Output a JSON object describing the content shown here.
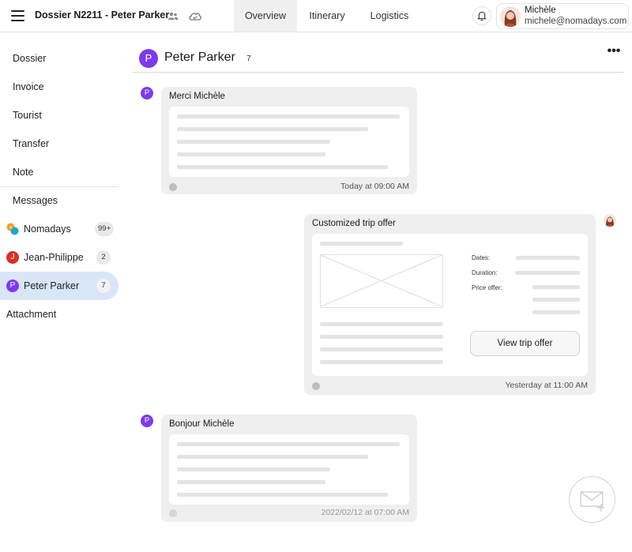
{
  "header": {
    "title": "Dossier N2211 - Peter Parker",
    "tabs": [
      {
        "label": "Overview",
        "active": true
      },
      {
        "label": "Itinerary",
        "active": false
      },
      {
        "label": "Logistics",
        "active": false
      }
    ],
    "user": {
      "name": "Michèle",
      "email": "michele@nomadays.com"
    },
    "icons": [
      "menu-icon",
      "people-icon",
      "cloud-icon",
      "bell-icon"
    ]
  },
  "sidebar": {
    "items": [
      {
        "label": "Dossier"
      },
      {
        "label": "Invoice"
      },
      {
        "label": "Tourist"
      },
      {
        "label": "Transfer"
      },
      {
        "label": "Note"
      },
      {
        "label": "Messages"
      }
    ],
    "chats": [
      {
        "label": "Nomadays",
        "badge": "99+"
      },
      {
        "label": "Jean-Philippe",
        "avatar": "J",
        "badge": "2",
        "avatar_color": "#d93025"
      },
      {
        "label": "Peter Parker",
        "avatar": "P",
        "badge": "7",
        "avatar_color": "#7c3aed",
        "active": true
      }
    ],
    "attachment_label": "Attachment"
  },
  "conversation": {
    "avatar": "P",
    "title": "Peter Parker",
    "count": "7",
    "more_icon": "•••",
    "messages": [
      {
        "avatar": "P",
        "title": "Merci Michèle",
        "time": "Today at 09:00 AM"
      },
      {
        "title": "Customized trip offer",
        "time": "Yesterday at 11:00 AM",
        "fields": {
          "dates": "Dates:",
          "duration": "Duration:",
          "price": "Price offer:"
        },
        "button": "View trip offer"
      },
      {
        "avatar": "P",
        "title": "Bonjour Michèle",
        "time": "2022/02/12 at 07:00 AM"
      }
    ]
  },
  "colors": {
    "accent_purple": "#7c3aed",
    "active_chat_bg": "#d8e6f8",
    "jean_red": "#d93025"
  }
}
